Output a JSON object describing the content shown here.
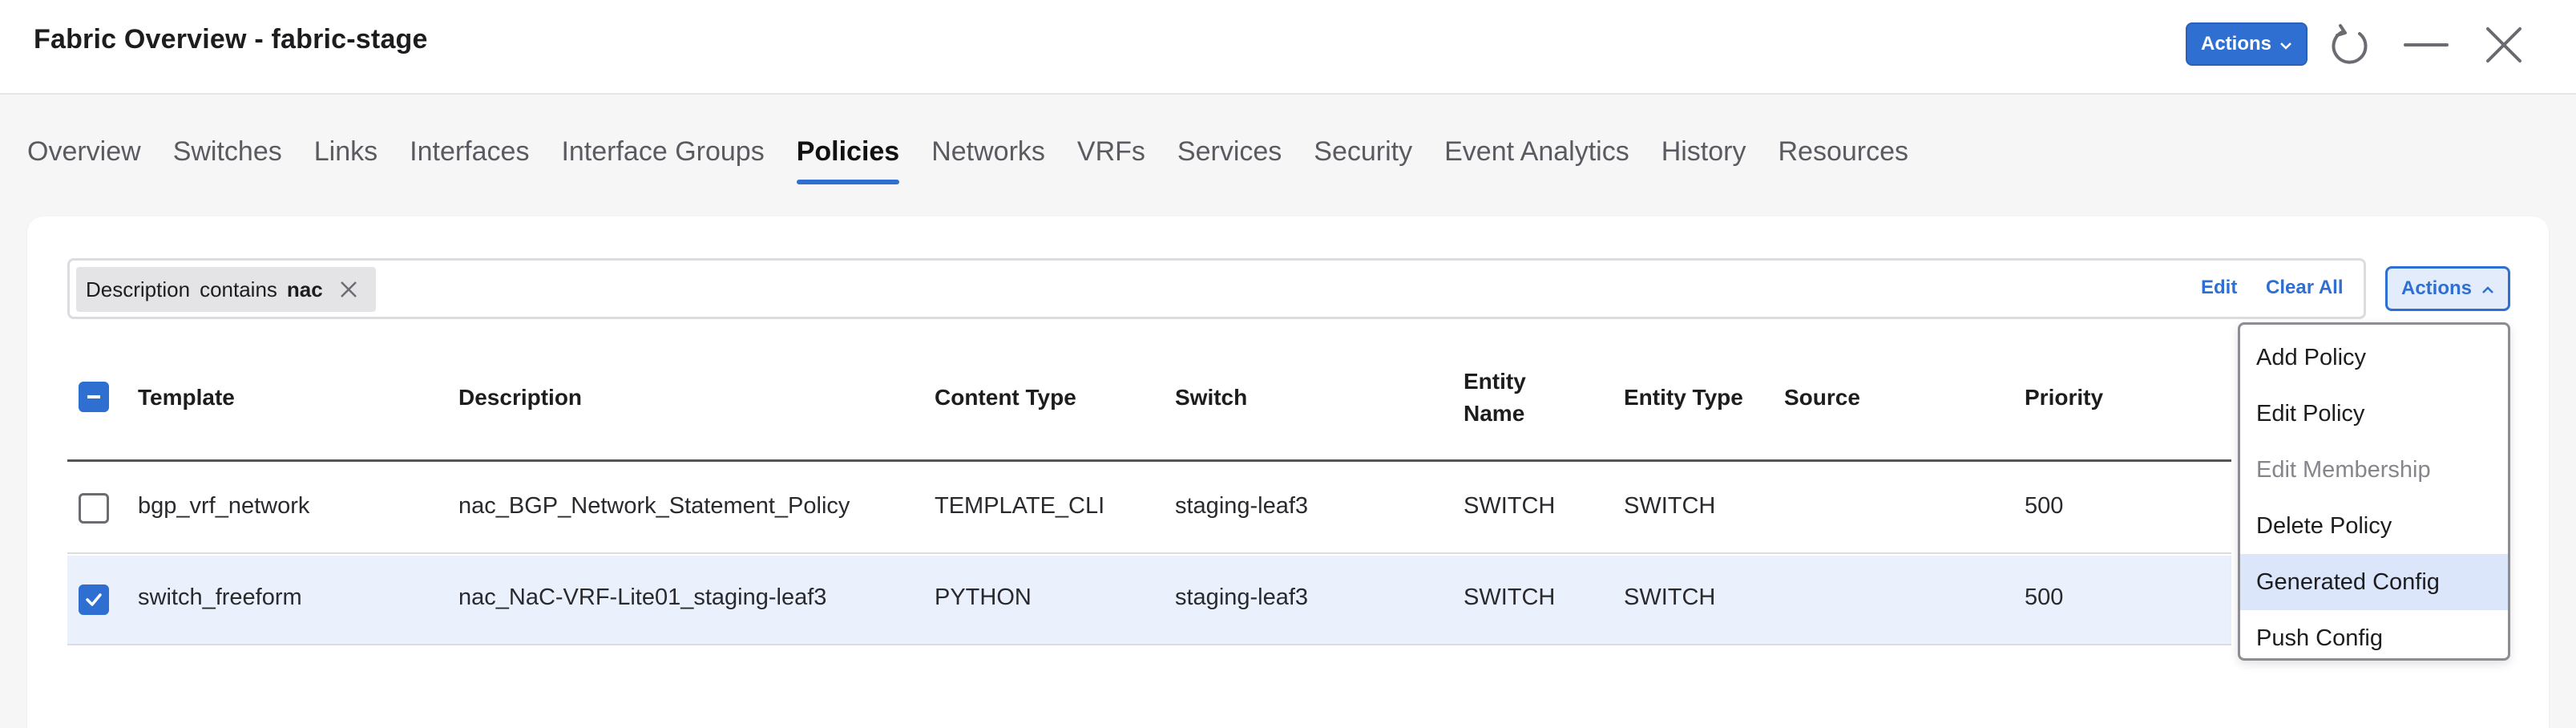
{
  "header": {
    "title": "Fabric Overview - fabric-stage",
    "actions_label": "Actions",
    "icons": [
      "chevron-down-icon",
      "refresh-icon",
      "minimize-icon",
      "close-icon"
    ]
  },
  "tabs": [
    {
      "label": "Overview"
    },
    {
      "label": "Switches"
    },
    {
      "label": "Links"
    },
    {
      "label": "Interfaces"
    },
    {
      "label": "Interface Groups"
    },
    {
      "label": "Policies",
      "active": true
    },
    {
      "label": "Networks"
    },
    {
      "label": "VRFs"
    },
    {
      "label": "Services"
    },
    {
      "label": "Security"
    },
    {
      "label": "Event Analytics"
    },
    {
      "label": "History"
    },
    {
      "label": "Resources"
    }
  ],
  "filter": {
    "chip": {
      "field": "Description",
      "operator": "contains",
      "value": "nac"
    },
    "edit_label": "Edit",
    "clear_label": "Clear All"
  },
  "card_actions_label": "Actions",
  "table": {
    "columns": {
      "template": "Template",
      "description": "Description",
      "content_type": "Content Type",
      "switch": "Switch",
      "entity_name_1": "Entity",
      "entity_name_2": "Name",
      "entity_type": "Entity Type",
      "source": "Source",
      "priority": "Priority"
    },
    "rows": [
      {
        "template": "bgp_vrf_network",
        "description": "nac_BGP_Network_Statement_Policy",
        "content_type": "TEMPLATE_CLI",
        "switch": "staging-leaf3",
        "entity_name": "SWITCH",
        "entity_type": "SWITCH",
        "source": "",
        "priority": "500",
        "checked": false
      },
      {
        "template": "switch_freeform",
        "description": "nac_NaC-VRF-Lite01_staging-leaf3",
        "content_type": "PYTHON",
        "switch": "staging-leaf3",
        "entity_name": "SWITCH",
        "entity_type": "SWITCH",
        "source": "",
        "priority": "500",
        "checked": true
      }
    ]
  },
  "menu": {
    "items": [
      {
        "label": "Add Policy",
        "state": "normal"
      },
      {
        "label": "Edit Policy",
        "state": "normal"
      },
      {
        "label": "Edit Membership",
        "state": "disabled"
      },
      {
        "label": "Delete Policy",
        "state": "normal"
      },
      {
        "label": "Generated Config",
        "state": "highlight"
      },
      {
        "label": "Push Config",
        "state": "normal"
      }
    ]
  },
  "colors": {
    "accent": "#2f6fd1",
    "selected_row": "#eaf1fc",
    "menu_highlight": "#dbe6fa"
  }
}
